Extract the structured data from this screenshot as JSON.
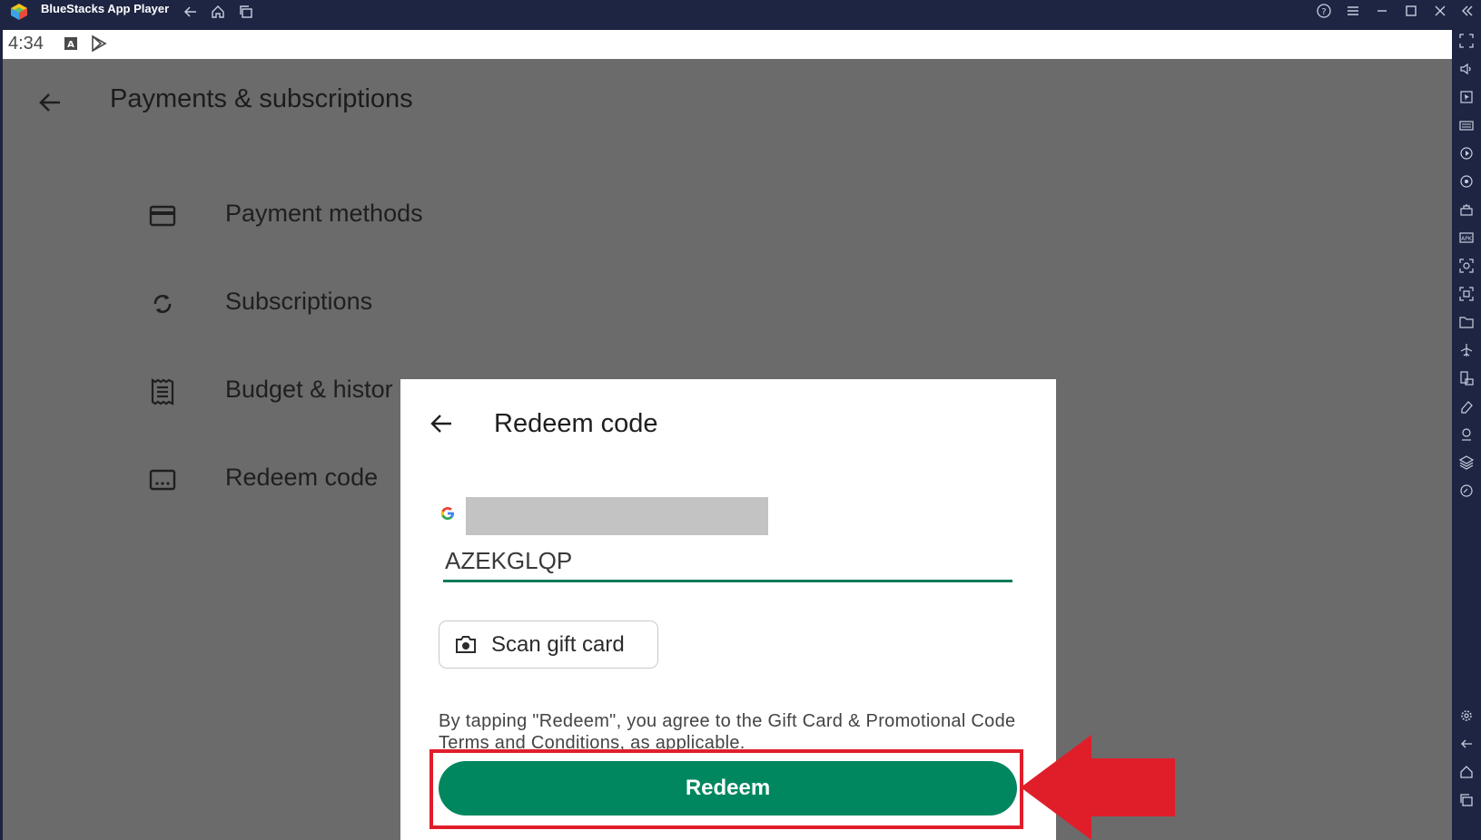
{
  "window": {
    "app_title": "BlueStacks App Player"
  },
  "android_status": {
    "time": "4:34"
  },
  "page": {
    "title": "Payments & subscriptions",
    "menu": [
      {
        "label": "Payment methods",
        "icon": "credit-card-icon"
      },
      {
        "label": "Subscriptions",
        "icon": "sync-icon"
      },
      {
        "label": "Budget & histor",
        "icon": "receipt-icon"
      },
      {
        "label": "Redeem code",
        "icon": "redeem-code-icon"
      }
    ]
  },
  "dialog": {
    "title": "Redeem code",
    "account_icon": "google-g-icon",
    "code_value": "AZEKGLQP",
    "scan_label": "Scan gift card",
    "terms_prefix": "By tapping \"Redeem\", you agree to the Gift Card & Promotional Code ",
    "terms_link": "Terms and Conditions",
    "terms_suffix": ", as applicable.",
    "redeem_label": "Redeem"
  },
  "colors": {
    "accent_green": "#01875f",
    "input_underline": "#0b7a5a",
    "annotation_red": "#e01e2a",
    "scrim": "#6b6b6b",
    "window_frame": "#1e2542"
  }
}
